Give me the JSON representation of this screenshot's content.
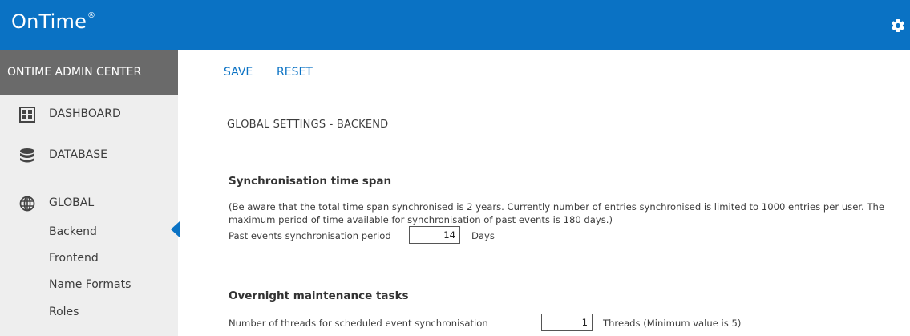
{
  "app": {
    "logo_text": "OnTime",
    "logo_mark": "®"
  },
  "icons": {
    "settings": "gear-icon",
    "dashboard": "dashboard-grid-icon",
    "database": "database-icon",
    "global": "globe-icon"
  },
  "colors": {
    "brand_blue": "#0a72c4",
    "sidebar_bg": "#eeeeee",
    "admin_header_bg": "#6a6a6a"
  },
  "sidebar": {
    "header": "ONTIME ADMIN CENTER",
    "items": [
      {
        "label": "DASHBOARD"
      },
      {
        "label": "DATABASE"
      },
      {
        "label": "GLOBAL"
      }
    ],
    "global_sub_items": [
      {
        "label": "Backend",
        "active": true
      },
      {
        "label": "Frontend"
      },
      {
        "label": "Name Formats"
      },
      {
        "label": "Roles"
      }
    ]
  },
  "toolbar": {
    "save_label": "SAVE",
    "reset_label": "RESET"
  },
  "main": {
    "title": "GLOBAL SETTINGS - BACKEND",
    "sync_section": {
      "title": "Synchronisation time span",
      "description": "(Be aware that the total time span synchronised is 2 years. Currently number of entries synchronised is limited to 1000 entries per user. The maximum period of time available for synchronisation of past events is 180 days.)",
      "field_label": "Past events synchronisation period",
      "value": "14",
      "unit": "Days"
    },
    "maintenance_section": {
      "title": "Overnight maintenance tasks",
      "field_label": "Number of threads for scheduled event synchronisation",
      "value": "1",
      "unit": "Threads (Minimum value is 5)"
    }
  }
}
